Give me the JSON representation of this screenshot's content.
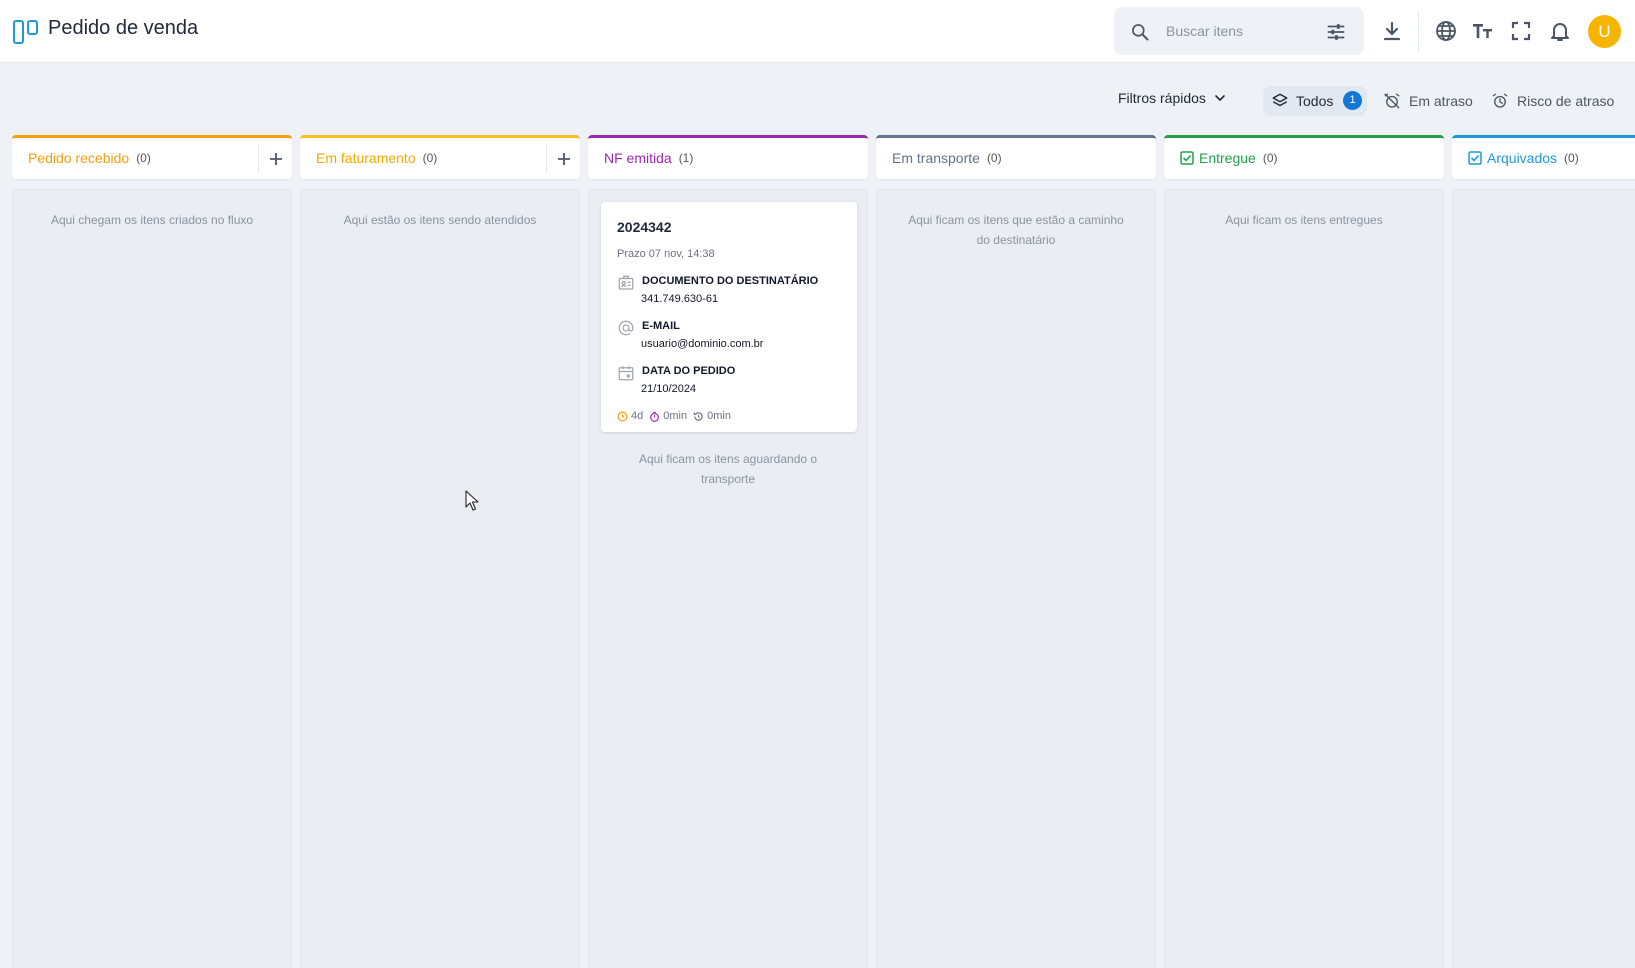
{
  "app": {
    "title": "Pedido de venda",
    "logo_icon": "kanban-icon"
  },
  "search": {
    "placeholder": "Buscar itens"
  },
  "toolbar_icons": [
    "download-icon",
    "globe-icon",
    "text-size-icon",
    "fullscreen-icon",
    "bell-icon"
  ],
  "user": {
    "avatar_initial": "U",
    "avatar_color": "#f7b500"
  },
  "filters": {
    "quick_label": "Filtros rápidos",
    "all_label": "Todos",
    "all_count": "1",
    "late_label": "Em atraso",
    "risk_label": "Risco de atraso"
  },
  "columns": [
    {
      "title": "Pedido recebido",
      "count": "(0)",
      "color": "#f59e0b",
      "empty": "Aqui chegam os itens criados no fluxo"
    },
    {
      "title": "Em faturamento",
      "count": "(0)",
      "color": "#fbbf24",
      "empty": "Aqui estão os itens sendo atendidos"
    },
    {
      "title": "NF emitida",
      "count": "(1)",
      "color": "#9c27b0",
      "empty": "Aqui ficam os itens aguardando o transporte"
    },
    {
      "title": "Em transporte",
      "count": "(0)",
      "color": "#64748b",
      "empty": "Aqui ficam os itens que estão a caminho do destinatário"
    },
    {
      "title": "Entregue",
      "count": "(0)",
      "color": "#22a04b",
      "empty": "Aqui ficam os itens entregues"
    },
    {
      "title": "Arquivados",
      "count": "(0)",
      "color": "#1e9bd7",
      "empty": ""
    }
  ],
  "card": {
    "code": "2024342",
    "deadline": "Prazo 07 nov, 14:38",
    "fields": [
      {
        "label": "DOCUMENTO DO DESTINATÁRIO",
        "value": "341.749.630-61",
        "icon": "id-card-icon"
      },
      {
        "label": "E-MAIL",
        "value": "usuario@dominio.com.br",
        "icon": "at-icon"
      },
      {
        "label": "DATA DO PEDIDO",
        "value": "21/10/2024",
        "icon": "calendar-icon"
      }
    ],
    "metrics": [
      {
        "value": "4d",
        "icon": "clock-icon",
        "color": "#f59e0b"
      },
      {
        "value": "0min",
        "icon": "stopwatch-icon",
        "color": "#9c27b0"
      },
      {
        "value": "0min",
        "icon": "history-icon",
        "color": "#6b7280"
      }
    ]
  }
}
